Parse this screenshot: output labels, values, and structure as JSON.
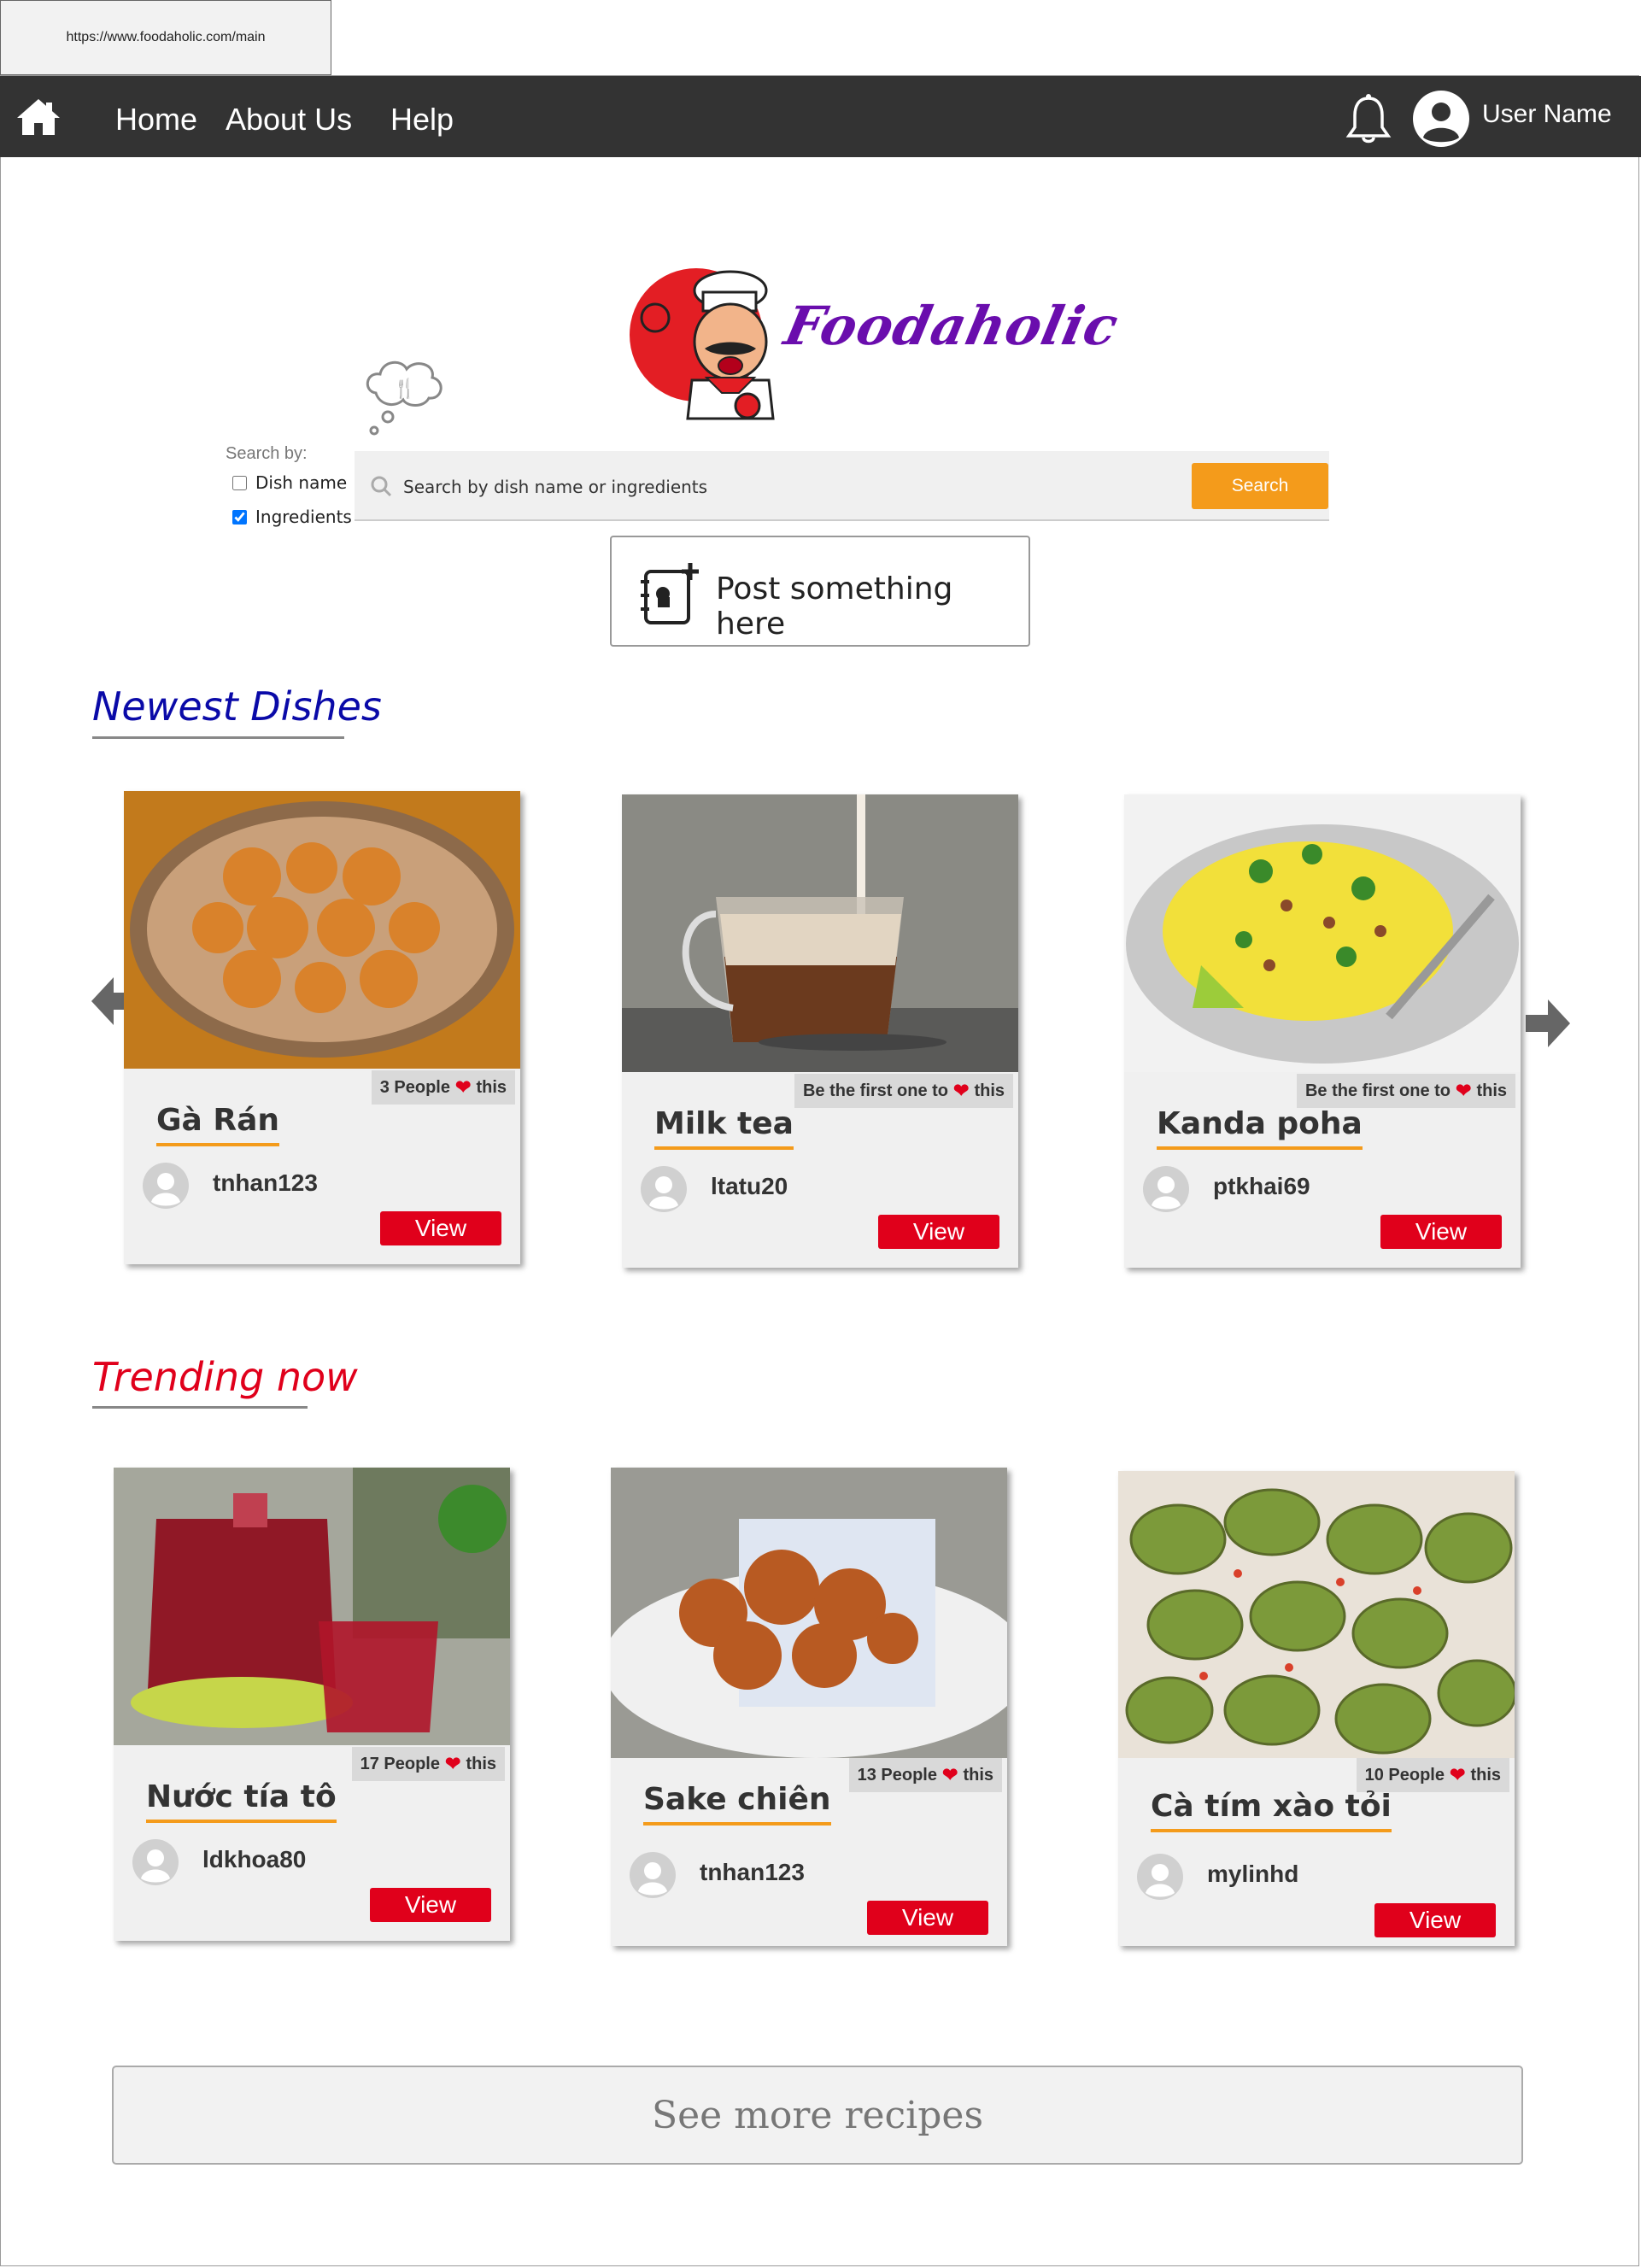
{
  "browser": {
    "url": "https://www.foodaholic.com/main"
  },
  "nav": {
    "links": [
      "Home",
      "About Us",
      "Help"
    ],
    "username": "User Name"
  },
  "brand": {
    "name": "Foodaholic"
  },
  "search": {
    "label": "Search by:",
    "options": [
      {
        "label": "Dish name",
        "checked": false
      },
      {
        "label": "Ingredients",
        "checked": true
      }
    ],
    "placeholder": "Search by dish name or ingredients",
    "button": "Search"
  },
  "post": {
    "label": "Post something here"
  },
  "newest": {
    "title": "Newest Dishes",
    "cards": [
      {
        "dish": "Gà Rán",
        "likes_prefix": "3 People",
        "likes_suffix": "this",
        "user": "tnhan123",
        "view": "View"
      },
      {
        "dish": "Milk tea",
        "likes_prefix": "Be the first one to",
        "likes_suffix": "this",
        "user": "ltatu20",
        "view": "View"
      },
      {
        "dish": "Kanda poha",
        "likes_prefix": "Be the first one to",
        "likes_suffix": "this",
        "user": "ptkhai69",
        "view": "View"
      }
    ]
  },
  "trending": {
    "title": "Trending now",
    "cards": [
      {
        "dish": "Nước tía tô",
        "likes_prefix": "17 People",
        "likes_suffix": "this",
        "user": "ldkhoa80",
        "view": "View"
      },
      {
        "dish": "Sake chiên",
        "likes_prefix": "13 People",
        "likes_suffix": "this",
        "user": "tnhan123",
        "view": "View"
      },
      {
        "dish": "Cà tím xào tỏi",
        "likes_prefix": "10 People",
        "likes_suffix": "this",
        "user": "mylinhd",
        "view": "View"
      }
    ]
  },
  "see_more": {
    "label": "See more recipes"
  },
  "colors": {
    "nav_bg": "#333333",
    "accent_orange": "#f49b1b",
    "view_red": "#e0001b",
    "newest_title": "#0a0aa8",
    "trending_title": "#e0001b",
    "brand_purple": "#6a0dad"
  }
}
